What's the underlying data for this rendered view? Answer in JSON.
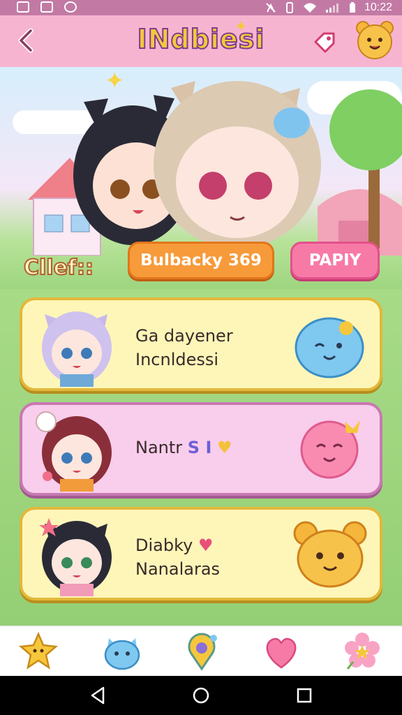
{
  "status_bar": {
    "time": "10:22",
    "left_icons": [
      "gallery-icon",
      "image-icon",
      "sync-icon"
    ],
    "right_icons": [
      "nfc-icon",
      "vibrate-icon",
      "wifi-icon",
      "signal-icon",
      "battery-icon"
    ]
  },
  "header": {
    "title": "INdbiesi",
    "back_icon": "chevron-left-icon",
    "tag_icon": "tag-icon",
    "profile_icon": "bear-face-icon"
  },
  "hero": {
    "cast_label": "Cllef::",
    "primary_button": "Bulbacky 369",
    "secondary_button": "PAPIY"
  },
  "cards": [
    {
      "line1": "Ga dayener",
      "line2": "Incnldessi",
      "color": "#fdf6b8",
      "pet": "blue-blob-icon"
    },
    {
      "line1": "Nantr",
      "badge": "S I",
      "line2": "",
      "color": "#f9cdec",
      "pet": "pink-blob-icon"
    },
    {
      "line1": "Diabky",
      "line2": "Nanalaras",
      "color": "#fdf6b8",
      "pet": "orange-bear-icon"
    }
  ],
  "bottom_nav": {
    "items": [
      "star-house-icon",
      "blue-creature-icon",
      "location-pin-icon",
      "heart-icon",
      "flower-icon"
    ]
  },
  "system_bar": {
    "buttons": [
      "back-triangle-icon",
      "home-circle-icon",
      "recents-square-icon"
    ]
  },
  "colors": {
    "header": "#f7b4d0",
    "accent_orange": "#f79a3a",
    "accent_pink": "#f77aa6",
    "card_yellow": "#fdf6b8",
    "card_pink": "#f9cdec"
  }
}
